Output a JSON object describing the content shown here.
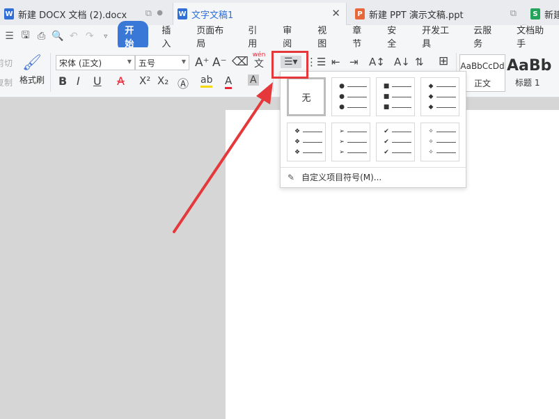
{
  "tabs": [
    {
      "label": "新建 DOCX 文档 (2).docx",
      "icon": "W",
      "color": "#2f6fd6"
    },
    {
      "label": "文字文稿1",
      "icon": "W",
      "color": "#2f6fd6"
    },
    {
      "label": "新建 PPT 演示文稿.ppt",
      "icon": "P",
      "color": "#e6673a"
    },
    {
      "label": "新建",
      "icon": "S",
      "color": "#23a45a"
    }
  ],
  "menu": [
    "开始",
    "插入",
    "页面布局",
    "引用",
    "审阅",
    "视图",
    "章节",
    "安全",
    "开发工具",
    "云服务",
    "文档助手"
  ],
  "ribbon": {
    "cut_label": "剪切",
    "copy_label": "复制",
    "format_painter": "格式刷",
    "font_name": "宋体 (正文)",
    "font_size": "五号",
    "wen_label": "wén",
    "wen_char": "文",
    "styles": [
      {
        "sample": "AaBbCcDd",
        "name": "正文"
      },
      {
        "sample": "AaBb",
        "name": "标题 1"
      }
    ]
  },
  "dropdown": {
    "none_label": "无",
    "row1": [
      "●",
      "■",
      "◆"
    ],
    "row2": [
      "❖",
      "➢",
      "✔",
      "✧"
    ],
    "custom_label": "自定义项目符号(M)..."
  }
}
